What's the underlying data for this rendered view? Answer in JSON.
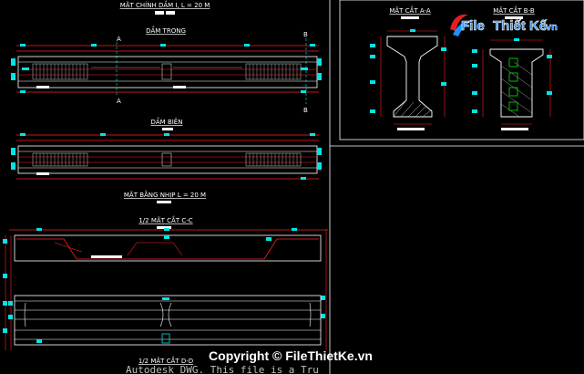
{
  "colors": {
    "background": "#000000",
    "beam_outline": "#ffffff",
    "dimension": "#ff2020",
    "marker": "#00e5e5",
    "hatch": "#cfcfcf",
    "rebar": "#00d000",
    "watermark_blue": "#1e90ff",
    "watermark_red": "#e02020"
  },
  "titles": {
    "main_elevation": "MẶT CHÍNH DẦM I, L = 20 M",
    "inner_beam": "DẦM TRONG",
    "edge_beam": "DẦM BIÊN",
    "plan_view": "MẶT BẰNG NHỊP L = 20 M",
    "half_section_cc": "1/2 MẶT CẮT C-C",
    "half_section_dd": "1/2 MẶT CẮT D-D",
    "section_aa": "MẶT CẮT A-A",
    "section_bb": "MẶT CẮT B-B"
  },
  "section_markers": {
    "a": "A",
    "b": "B"
  },
  "watermark": {
    "logo_file": "File",
    "logo_thietke": "Thiết Kế",
    "logo_vn": ".vn",
    "copyright": "Copyright © FileThietKe.vn"
  },
  "cad_notice": "Autodesk DWG.  This file is a Tru"
}
